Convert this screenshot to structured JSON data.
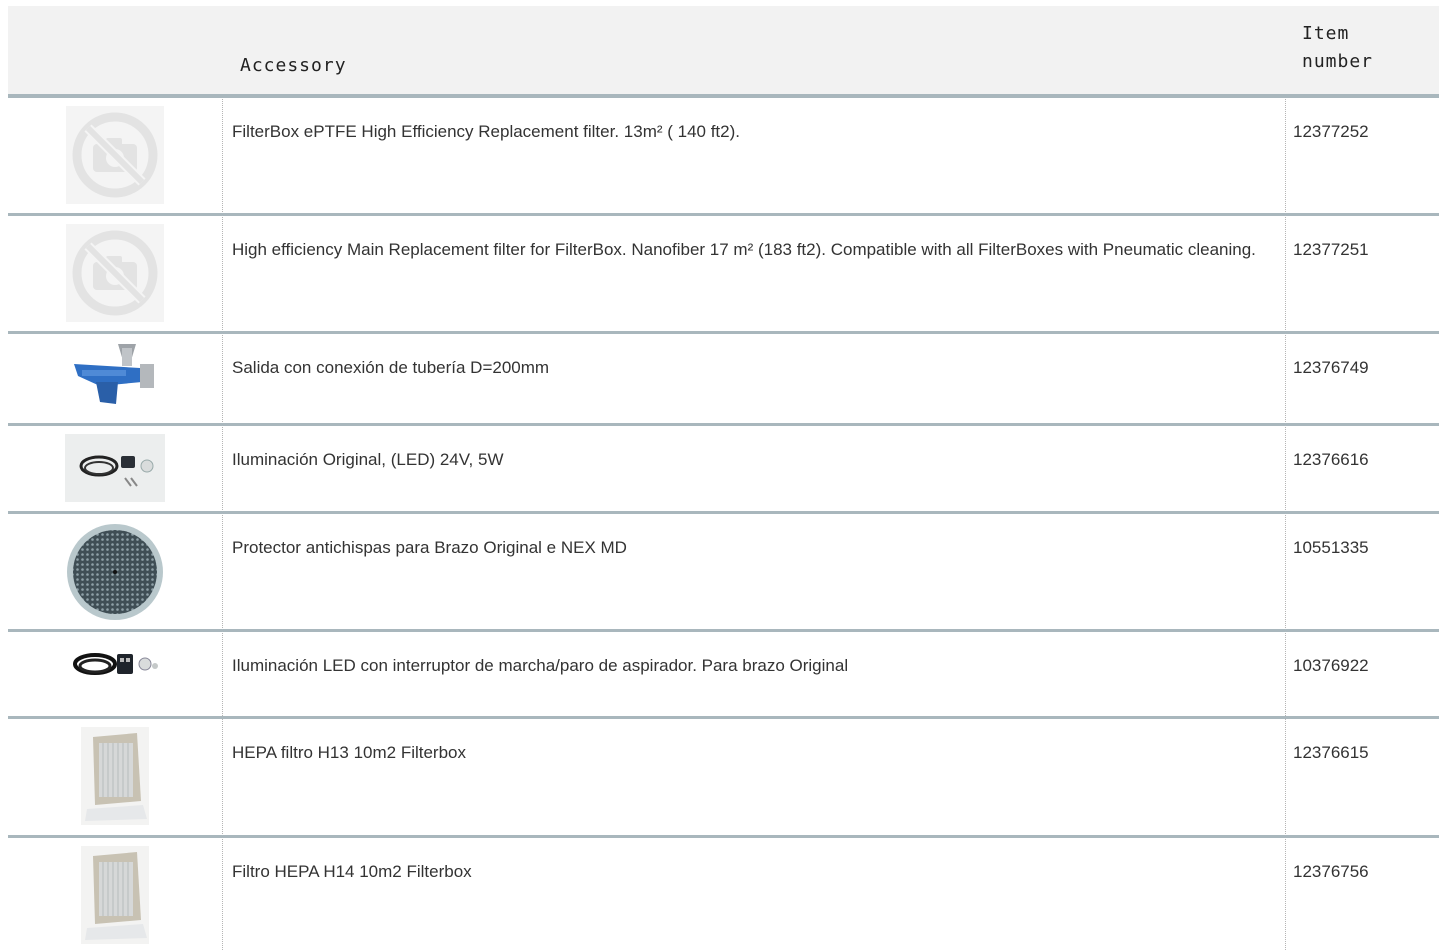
{
  "header": {
    "image_col": "",
    "accessory": "Accessory",
    "item_number_line1": "Item",
    "item_number_line2": "number"
  },
  "rows": [
    {
      "description": "FilterBox ePTFE High Efficiency Replacement filter. 13m² ( 140 ft2).",
      "item_number": "12377252",
      "image": "no-image-icon"
    },
    {
      "description": "High efficiency Main Replacement filter for FilterBox. Nanofiber 17 m² (183 ft2). Compatible with all FilterBoxes with Pneumatic cleaning.",
      "item_number": "12377251",
      "image": "no-image-icon"
    },
    {
      "description": "Salida con conexión de tubería D=200mm",
      "item_number": "12376749",
      "image": "outlet-pipe-connection-image"
    },
    {
      "description": "Iluminación Original, (LED) 24V, 5W",
      "item_number": "12376616",
      "image": "led-lighting-kit-image"
    },
    {
      "description": "Protector antichispas para Brazo Original e NEX MD",
      "item_number": "10551335",
      "image": "spark-protector-image"
    },
    {
      "description": "Iluminación LED con interruptor de marcha/paro de aspirador. Para brazo Original",
      "item_number": "10376922",
      "image": "led-switch-kit-image"
    },
    {
      "description": "HEPA filtro H13 10m2 Filterbox",
      "item_number": "12376615",
      "image": "hepa-filter-image"
    },
    {
      "description": "Filtro HEPA H14 10m2 Filterbox",
      "item_number": "12376756",
      "image": "hepa-filter-image"
    }
  ]
}
